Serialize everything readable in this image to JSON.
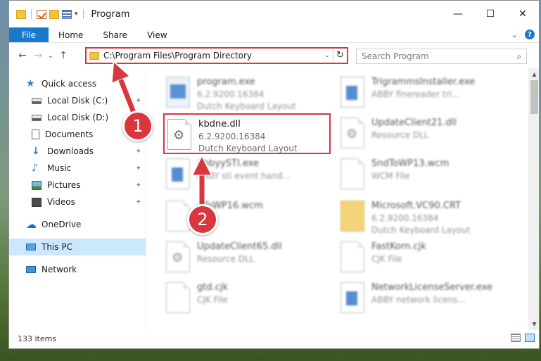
{
  "window": {
    "title": "Program",
    "minimize_glyph": "—",
    "maximize_glyph": "☐",
    "close_glyph": "✕"
  },
  "ribbon": {
    "tabs": [
      {
        "label": "File"
      },
      {
        "label": "Home"
      },
      {
        "label": "Share"
      },
      {
        "label": "View"
      }
    ],
    "expand_glyph": "⌄",
    "help_glyph": "?"
  },
  "nav": {
    "back_glyph": "←",
    "forward_glyph": "→",
    "recent_glyph": "⌄",
    "up_glyph": "↑",
    "address": "C:\\Program Files\\Program Directory",
    "address_drop_glyph": "⌄",
    "refresh_glyph": "↻",
    "search_placeholder": "Search Program",
    "search_icon": "search-icon",
    "search_glyph": "⌕"
  },
  "sidebar": {
    "items": [
      {
        "label": "Quick access",
        "icon": "star-icon",
        "glyph": "★"
      },
      {
        "label": "Local Disk (C:)",
        "icon": "disk-icon",
        "pinned": true
      },
      {
        "label": "Local Disk (D:)",
        "icon": "disk-icon",
        "pinned": true
      },
      {
        "label": "Documents",
        "icon": "document-icon",
        "pinned": true
      },
      {
        "label": "Downloads",
        "icon": "download-icon",
        "glyph": "↓",
        "pinned": true
      },
      {
        "label": "Music",
        "icon": "music-icon",
        "glyph": "♪",
        "pinned": true
      },
      {
        "label": "Pictures",
        "icon": "pictures-icon",
        "pinned": true
      },
      {
        "label": "Videos",
        "icon": "videos-icon",
        "pinned": true
      },
      {
        "label": "OneDrive",
        "icon": "cloud-icon",
        "glyph": "☁"
      },
      {
        "label": "This PC",
        "icon": "computer-icon",
        "selected": true
      },
      {
        "label": "Network",
        "icon": "network-icon"
      }
    ],
    "pin_glyph": "✦"
  },
  "files": [
    {
      "name": "program.exe",
      "line2": "6.2.9200.16384",
      "line3": "Dutch Keyboard Layout",
      "icon": "application-icon"
    },
    {
      "name": "TrigrammsInstaller.exe",
      "line2": "ABBY finereader tri...",
      "line3": "",
      "icon": "window-icon"
    },
    {
      "name": "kbdne.dll",
      "line2": "6.2.9200.16384",
      "line3": "Dutch Keyboard Layout",
      "icon": "dll-gear-icon"
    },
    {
      "name": "UpdateClient21.dll",
      "line2": "Resource DLL",
      "line3": "",
      "icon": "dll-gear-icon"
    },
    {
      "name": "AbbyySTI.exe",
      "line2": "ABBY sti event hand...",
      "line3": "",
      "icon": "window-icon"
    },
    {
      "name": "SndToWP13.wcm",
      "line2": "WCM File",
      "line3": "",
      "icon": "page-icon"
    },
    {
      "name": "dToWP16.wcm",
      "line2": "File",
      "line3": "",
      "icon": "page-icon"
    },
    {
      "name": "Microsoft.VC90.CRT",
      "line2": "6.2.9200.16384",
      "line3": "Dutch Keyboard Layout",
      "icon": "folder-icon"
    },
    {
      "name": "UpdateClient65.dll",
      "line2": "Resource DLL",
      "line3": "",
      "icon": "dll-gear-icon"
    },
    {
      "name": "FastKorn.cjk",
      "line2": "CJK File",
      "line3": "",
      "icon": "page-icon"
    },
    {
      "name": "gtd.cjk",
      "line2": "CJK File",
      "line3": "",
      "icon": "page-icon"
    },
    {
      "name": "NetworkLicenseServer.exe",
      "line2": "ABBY network licens...",
      "line3": "",
      "icon": "window-icon"
    }
  ],
  "status": {
    "item_count": "133 items"
  },
  "scroll": {
    "up_glyph": "▲",
    "down_glyph": "▼"
  },
  "callouts": [
    {
      "label": "1"
    },
    {
      "label": "2"
    }
  ],
  "colors": {
    "accent": "#1979ca",
    "highlight": "#d9363e",
    "selection": "#cce8ff"
  }
}
